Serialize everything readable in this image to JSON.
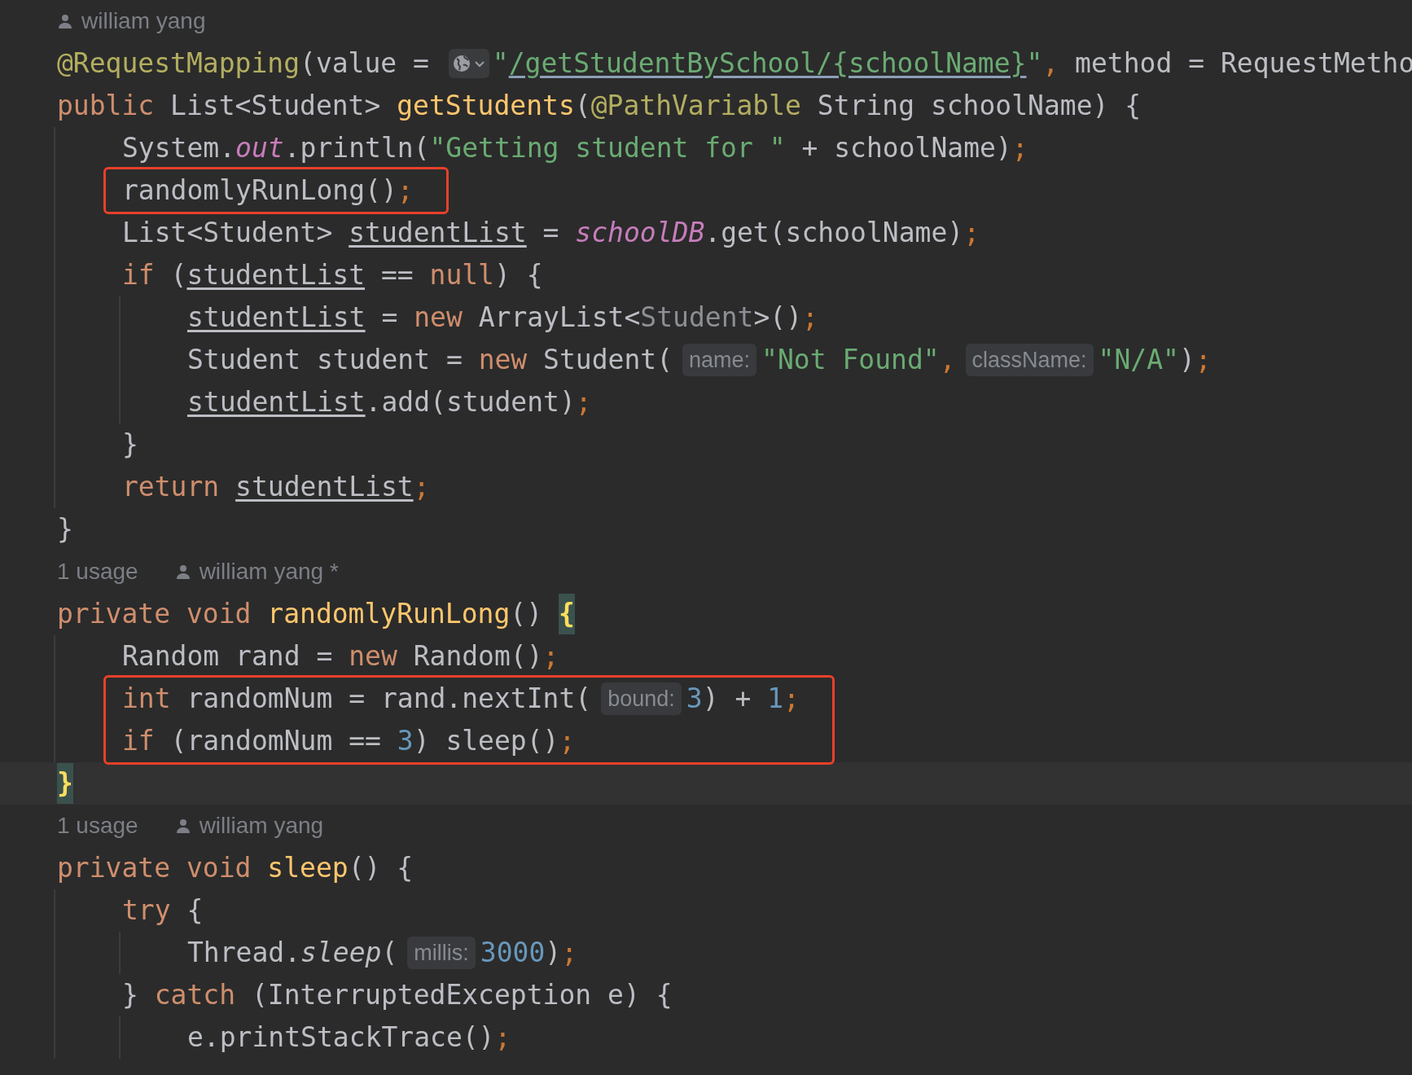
{
  "editor": {
    "lines": [
      {
        "kind": "hint",
        "author": "william yang"
      },
      {
        "kind": "code",
        "current": false,
        "tokens": [
          {
            "kind": "annotation",
            "text": "@RequestMapping"
          },
          {
            "kind": "plain",
            "text": "(value = "
          },
          {
            "kind": "inlay"
          },
          {
            "kind": "string",
            "text": "\""
          },
          {
            "kind": "link",
            "text": "/getStudentBySchool/{schoolName}"
          },
          {
            "kind": "string",
            "text": "\""
          },
          {
            "kind": "punct",
            "text": ","
          },
          {
            "kind": "plain",
            "text": " method = RequestMetho"
          }
        ]
      },
      {
        "kind": "code",
        "current": false,
        "tokens": [
          {
            "kind": "keyword",
            "text": "public "
          },
          {
            "kind": "plain",
            "text": "List<Student> "
          },
          {
            "kind": "function",
            "text": "getStudents"
          },
          {
            "kind": "plain",
            "text": "("
          },
          {
            "kind": "annotation",
            "text": "@PathVariable"
          },
          {
            "kind": "plain",
            "text": " String schoolName) {"
          }
        ],
        "children": [
          {
            "kind": "code",
            "tokens": [
              {
                "kind": "plain",
                "text": "System."
              },
              {
                "kind": "static",
                "text": "out"
              },
              {
                "kind": "plain",
                "text": ".println("
              },
              {
                "kind": "string",
                "text": "\"Getting student for \""
              },
              {
                "kind": "plain",
                "text": " + schoolName)"
              },
              {
                "kind": "punct",
                "text": ";"
              }
            ]
          },
          {
            "kind": "box",
            "lines": [
              {
                "kind": "code",
                "tokens": [
                  {
                    "kind": "plain",
                    "text": "randomlyRunLong()"
                  },
                  {
                    "kind": "punct",
                    "text": ";"
                  }
                ]
              }
            ]
          },
          {
            "kind": "code",
            "tokens": [
              {
                "kind": "plain",
                "text": "List<Student> "
              },
              {
                "kind": "underlined",
                "text": "studentList"
              },
              {
                "kind": "plain",
                "text": " = "
              },
              {
                "kind": "static",
                "text": "schoolDB"
              },
              {
                "kind": "plain",
                "text": ".get(schoolName)"
              },
              {
                "kind": "punct",
                "text": ";"
              }
            ]
          },
          {
            "kind": "code",
            "tokens": [
              {
                "kind": "keyword",
                "text": "if "
              },
              {
                "kind": "plain",
                "text": "("
              },
              {
                "kind": "underlined",
                "text": "studentList"
              },
              {
                "kind": "plain",
                "text": " == "
              },
              {
                "kind": "keyword",
                "text": "null"
              },
              {
                "kind": "plain",
                "text": ") {"
              }
            ],
            "children": [
              {
                "kind": "code",
                "tokens": [
                  {
                    "kind": "underlined",
                    "text": "studentList"
                  },
                  {
                    "kind": "plain",
                    "text": " = "
                  },
                  {
                    "kind": "keyword",
                    "text": "new "
                  },
                  {
                    "kind": "plain",
                    "text": "ArrayList<"
                  },
                  {
                    "kind": "muted",
                    "text": "Student"
                  },
                  {
                    "kind": "plain",
                    "text": ">()"
                  },
                  {
                    "kind": "punct",
                    "text": ";"
                  }
                ]
              },
              {
                "kind": "code",
                "tokens": [
                  {
                    "kind": "plain",
                    "text": "Student student = "
                  },
                  {
                    "kind": "keyword",
                    "text": "new "
                  },
                  {
                    "kind": "plain",
                    "text": "Student("
                  },
                  {
                    "kind": "hint",
                    "text": "name:"
                  },
                  {
                    "kind": "string",
                    "text": "\"Not Found\""
                  },
                  {
                    "kind": "punct",
                    "text": ","
                  },
                  {
                    "kind": "hint",
                    "text": "className:"
                  },
                  {
                    "kind": "string",
                    "text": "\"N/A\""
                  },
                  {
                    "kind": "plain",
                    "text": ")"
                  },
                  {
                    "kind": "punct",
                    "text": ";"
                  }
                ]
              },
              {
                "kind": "code",
                "tokens": [
                  {
                    "kind": "underlined",
                    "text": "studentList"
                  },
                  {
                    "kind": "plain",
                    "text": ".add(student)"
                  },
                  {
                    "kind": "punct",
                    "text": ";"
                  }
                ]
              }
            ]
          },
          {
            "kind": "code",
            "tokens": [
              {
                "kind": "plain",
                "text": "}"
              }
            ]
          },
          {
            "kind": "code",
            "tokens": [
              {
                "kind": "keyword",
                "text": "return "
              },
              {
                "kind": "underlined",
                "text": "studentList"
              },
              {
                "kind": "punct",
                "text": ";"
              }
            ]
          }
        ]
      },
      {
        "kind": "code",
        "current": false,
        "tokens": [
          {
            "kind": "plain",
            "text": "}"
          }
        ]
      },
      {
        "kind": "hint",
        "usage": "1 usage",
        "author": "william yang *"
      },
      {
        "kind": "code",
        "current": false,
        "tokens": [
          {
            "kind": "keyword",
            "text": "private void "
          },
          {
            "kind": "function",
            "text": "randomlyRunLong"
          },
          {
            "kind": "plain",
            "text": "() "
          },
          {
            "kind": "brace",
            "text": "{"
          }
        ],
        "children": [
          {
            "kind": "code",
            "tokens": [
              {
                "kind": "plain",
                "text": "Random rand = "
              },
              {
                "kind": "keyword",
                "text": "new "
              },
              {
                "kind": "plain",
                "text": "Random()"
              },
              {
                "kind": "punct",
                "text": ";"
              }
            ]
          },
          {
            "kind": "box",
            "lines": [
              {
                "kind": "code",
                "tokens": [
                  {
                    "kind": "keyword",
                    "text": "int "
                  },
                  {
                    "kind": "plain",
                    "text": "randomNum = rand.nextInt("
                  },
                  {
                    "kind": "hint",
                    "text": "bound:"
                  },
                  {
                    "kind": "number",
                    "text": "3"
                  },
                  {
                    "kind": "plain",
                    "text": ") + "
                  },
                  {
                    "kind": "number",
                    "text": "1"
                  },
                  {
                    "kind": "punct",
                    "text": ";"
                  }
                ]
              },
              {
                "kind": "code",
                "tokens": [
                  {
                    "kind": "keyword",
                    "text": "if "
                  },
                  {
                    "kind": "plain",
                    "text": "(randomNum == "
                  },
                  {
                    "kind": "number",
                    "text": "3"
                  },
                  {
                    "kind": "plain",
                    "text": ") sleep()"
                  },
                  {
                    "kind": "punct",
                    "text": ";"
                  }
                ]
              }
            ]
          }
        ]
      },
      {
        "kind": "code",
        "current": true,
        "tokens": [
          {
            "kind": "brace",
            "text": "}"
          }
        ]
      },
      {
        "kind": "hint",
        "usage": "1 usage",
        "author": "william yang"
      },
      {
        "kind": "code",
        "current": false,
        "tokens": [
          {
            "kind": "keyword",
            "text": "private void "
          },
          {
            "kind": "function",
            "text": "sleep"
          },
          {
            "kind": "plain",
            "text": "() {"
          }
        ],
        "children": [
          {
            "kind": "code",
            "tokens": [
              {
                "kind": "keyword",
                "text": "try "
              },
              {
                "kind": "plain",
                "text": "{"
              }
            ],
            "children": [
              {
                "kind": "code",
                "tokens": [
                  {
                    "kind": "plain",
                    "text": "Thread."
                  },
                  {
                    "kind": "italic",
                    "text": "sleep"
                  },
                  {
                    "kind": "plain",
                    "text": "("
                  },
                  {
                    "kind": "hint",
                    "text": "millis:"
                  },
                  {
                    "kind": "number",
                    "text": "3000"
                  },
                  {
                    "kind": "plain",
                    "text": ")"
                  },
                  {
                    "kind": "punct",
                    "text": ";"
                  }
                ]
              }
            ]
          },
          {
            "kind": "code",
            "tokens": [
              {
                "kind": "plain",
                "text": "} "
              },
              {
                "kind": "keyword",
                "text": "catch "
              },
              {
                "kind": "plain",
                "text": "(InterruptedException e) {"
              }
            ],
            "children": [
              {
                "kind": "code",
                "tokens": [
                  {
                    "kind": "plain",
                    "text": "e.printStackTrace()"
                  },
                  {
                    "kind": "punct",
                    "text": ";"
                  }
                ]
              }
            ]
          }
        ]
      }
    ]
  }
}
